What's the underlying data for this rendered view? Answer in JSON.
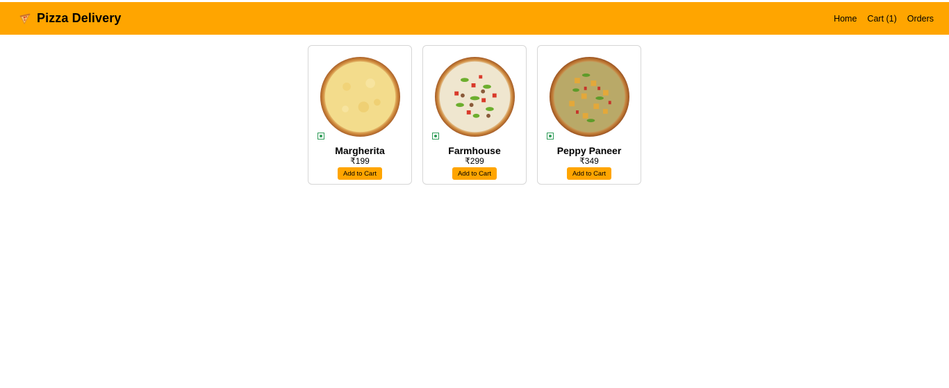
{
  "header": {
    "brand_icon": "pizza-slice-icon",
    "title": "Pizza Delivery",
    "accent_color": "#ffa500",
    "nav": [
      {
        "label": "Home"
      },
      {
        "label": "Cart (1)"
      },
      {
        "label": "Orders"
      }
    ]
  },
  "products": [
    {
      "name": "Margherita",
      "price": "₹199",
      "button_label": "Add to Cart",
      "veg": true,
      "image": "margherita-pizza"
    },
    {
      "name": "Farmhouse",
      "price": "₹299",
      "button_label": "Add to Cart",
      "veg": true,
      "image": "farmhouse-pizza"
    },
    {
      "name": "Peppy Paneer",
      "price": "₹349",
      "button_label": "Add to Cart",
      "veg": true,
      "image": "peppy-paneer-pizza"
    }
  ],
  "colors": {
    "veg_green": "#2e9b57",
    "card_border": "#d6d6d6"
  }
}
